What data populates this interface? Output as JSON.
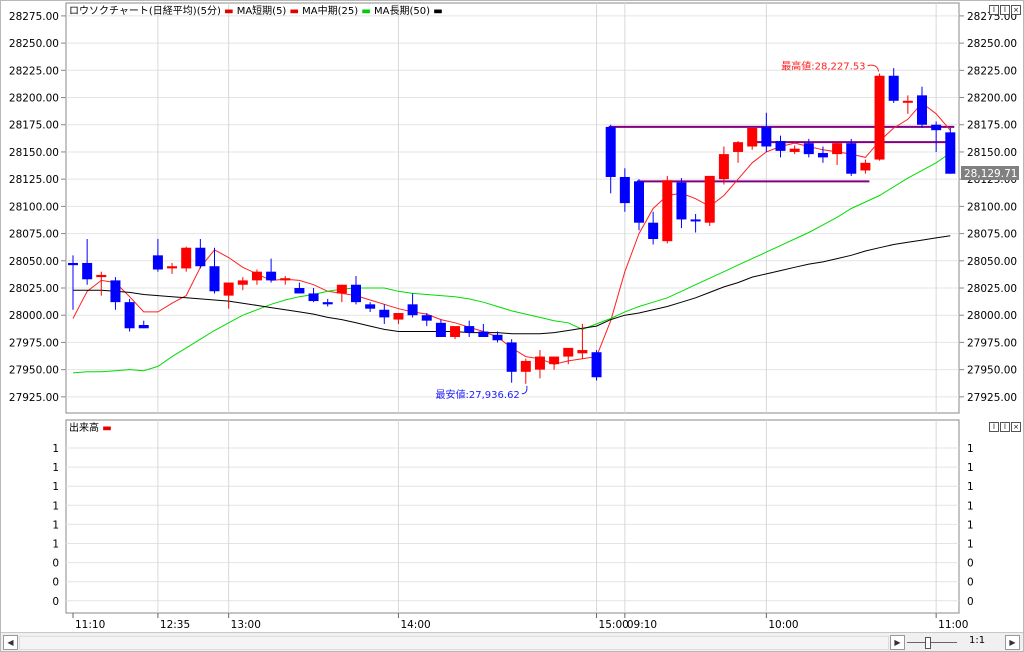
{
  "legend": {
    "title": "ロウソクチャート(日経平均)(5分)",
    "items": [
      {
        "label": "MA短期(5)",
        "color": "#e00000"
      },
      {
        "label": "MA中期(25)",
        "color": "#e00000"
      },
      {
        "label": "MA長期(50)",
        "color": "#00cc00"
      },
      {
        "label": "",
        "color": "#000000"
      }
    ]
  },
  "volume_panel": {
    "title": "出来高",
    "y_ticks": [
      "1",
      "1",
      "1",
      "1",
      "1",
      "1",
      "0",
      "0",
      "0"
    ]
  },
  "colors": {
    "up": "#ff0000",
    "down": "#0000ff",
    "ma_short": "#ff2020",
    "ma_mid": "#00dd00",
    "ma_long": "#000000",
    "range_lines": "#800080",
    "max_label": "#ff2020",
    "min_label": "#2020ff"
  },
  "scrollbar": {
    "zoom_label": "1:1"
  },
  "chart_data": {
    "type": "candlestick",
    "title": "ロウソクチャート(日経平均)(5分)",
    "y_ticks": [
      "28275.00",
      "28250.00",
      "28225.00",
      "28200.00",
      "28175.00",
      "28150.00",
      "28125.00",
      "28100.00",
      "28075.00",
      "28050.00",
      "28025.00",
      "28000.00",
      "27975.00",
      "27950.00",
      "27925.00"
    ],
    "ylim": [
      27912,
      28285
    ],
    "x_ticks": [
      "11:10",
      "12:35",
      "13:00",
      "14:00",
      "15:00",
      "09:10",
      "10:00",
      "11:00"
    ],
    "x_tick_index": [
      0,
      6,
      11,
      23,
      37,
      39,
      49,
      61
    ],
    "session_breaks": [
      6,
      11,
      23,
      37,
      39,
      49,
      61
    ],
    "last_price": "28,129.71",
    "max_label": "最高値:28,227.53",
    "min_label": "最安値:27,936.62",
    "max_index": 57,
    "min_index": 32,
    "range_lines": [
      {
        "y": 28173,
        "from": 38,
        "to": 62
      },
      {
        "y": 28159,
        "from": 48,
        "to": 62
      },
      {
        "y": 28123,
        "from": 40,
        "to": 56
      }
    ],
    "candles": [
      {
        "o": 28048,
        "h": 28055,
        "l": 28005,
        "c": 28046
      },
      {
        "o": 28048,
        "h": 28070,
        "l": 28028,
        "c": 28033
      },
      {
        "o": 28035,
        "h": 28040,
        "l": 28018,
        "c": 28037
      },
      {
        "o": 28032,
        "h": 28035,
        "l": 28005,
        "c": 28012
      },
      {
        "o": 28012,
        "h": 28015,
        "l": 27985,
        "c": 27988
      },
      {
        "o": 27991,
        "h": 27995,
        "l": 27988,
        "c": 27988
      },
      {
        "o": 28055,
        "h": 28070,
        "l": 28040,
        "c": 28042
      },
      {
        "o": 28043,
        "h": 28048,
        "l": 28038,
        "c": 28045
      },
      {
        "o": 28043,
        "h": 28063,
        "l": 28040,
        "c": 28062
      },
      {
        "o": 28062,
        "h": 28070,
        "l": 28043,
        "c": 28045
      },
      {
        "o": 28045,
        "h": 28062,
        "l": 28020,
        "c": 28022
      },
      {
        "o": 28018,
        "h": 28025,
        "l": 28006,
        "c": 28030
      },
      {
        "o": 28028,
        "h": 28035,
        "l": 28023,
        "c": 28032
      },
      {
        "o": 28032,
        "h": 28042,
        "l": 28028,
        "c": 28040
      },
      {
        "o": 28040,
        "h": 28052,
        "l": 28030,
        "c": 28032
      },
      {
        "o": 28032,
        "h": 28036,
        "l": 28028,
        "c": 28034
      },
      {
        "o": 28025,
        "h": 28030,
        "l": 28020,
        "c": 28020
      },
      {
        "o": 28020,
        "h": 28025,
        "l": 28012,
        "c": 28013
      },
      {
        "o": 28012,
        "h": 28015,
        "l": 28008,
        "c": 28010
      },
      {
        "o": 28020,
        "h": 28028,
        "l": 28012,
        "c": 28028
      },
      {
        "o": 28028,
        "h": 28036,
        "l": 28010,
        "c": 28012
      },
      {
        "o": 28010,
        "h": 28012,
        "l": 28003,
        "c": 28006
      },
      {
        "o": 28005,
        "h": 28010,
        "l": 27992,
        "c": 27998
      },
      {
        "o": 27996,
        "h": 28000,
        "l": 27992,
        "c": 28002
      },
      {
        "o": 28010,
        "h": 28020,
        "l": 27998,
        "c": 28000
      },
      {
        "o": 28000,
        "h": 28002,
        "l": 27990,
        "c": 27995
      },
      {
        "o": 27993,
        "h": 27996,
        "l": 27980,
        "c": 27980
      },
      {
        "o": 27980,
        "h": 27985,
        "l": 27978,
        "c": 27990
      },
      {
        "o": 27990,
        "h": 27995,
        "l": 27980,
        "c": 27984
      },
      {
        "o": 27985,
        "h": 27992,
        "l": 27980,
        "c": 27980
      },
      {
        "o": 27982,
        "h": 27985,
        "l": 27975,
        "c": 27977
      },
      {
        "o": 27975,
        "h": 27978,
        "l": 27938,
        "c": 27948
      },
      {
        "o": 27948,
        "h": 27960,
        "l": 27937,
        "c": 27958
      },
      {
        "o": 27950,
        "h": 27968,
        "l": 27942,
        "c": 27962
      },
      {
        "o": 27955,
        "h": 27962,
        "l": 27950,
        "c": 27962
      },
      {
        "o": 27962,
        "h": 27968,
        "l": 27955,
        "c": 27970
      },
      {
        "o": 27965,
        "h": 27992,
        "l": 27960,
        "c": 27968
      },
      {
        "o": 27966,
        "h": 27968,
        "l": 27940,
        "c": 27943
      },
      {
        "o": 28173,
        "h": 28175,
        "l": 28112,
        "c": 28127
      },
      {
        "o": 28127,
        "h": 28135,
        "l": 28095,
        "c": 28103
      },
      {
        "o": 28123,
        "h": 28125,
        "l": 28078,
        "c": 28085
      },
      {
        "o": 28085,
        "h": 28095,
        "l": 28065,
        "c": 28070
      },
      {
        "o": 28068,
        "h": 28128,
        "l": 28066,
        "c": 28124
      },
      {
        "o": 28122,
        "h": 28126,
        "l": 28080,
        "c": 28088
      },
      {
        "o": 28088,
        "h": 28093,
        "l": 28076,
        "c": 28087
      },
      {
        "o": 28085,
        "h": 28125,
        "l": 28082,
        "c": 28128
      },
      {
        "o": 28125,
        "h": 28155,
        "l": 28120,
        "c": 28148
      },
      {
        "o": 28150,
        "h": 28160,
        "l": 28140,
        "c": 28159
      },
      {
        "o": 28155,
        "h": 28172,
        "l": 28152,
        "c": 28172
      },
      {
        "o": 28173,
        "h": 28186,
        "l": 28150,
        "c": 28155
      },
      {
        "o": 28160,
        "h": 28165,
        "l": 28145,
        "c": 28151
      },
      {
        "o": 28150,
        "h": 28156,
        "l": 28148,
        "c": 28153
      },
      {
        "o": 28158,
        "h": 28162,
        "l": 28145,
        "c": 28148
      },
      {
        "o": 28149,
        "h": 28155,
        "l": 28140,
        "c": 28145
      },
      {
        "o": 28148,
        "h": 28160,
        "l": 28138,
        "c": 28158
      },
      {
        "o": 28158,
        "h": 28162,
        "l": 28128,
        "c": 28130
      },
      {
        "o": 28133,
        "h": 28143,
        "l": 28130,
        "c": 28140
      },
      {
        "o": 28143,
        "h": 28222,
        "l": 28142,
        "c": 28220
      },
      {
        "o": 28220,
        "h": 28227,
        "l": 28195,
        "c": 28197
      },
      {
        "o": 28197,
        "h": 28202,
        "l": 28185,
        "c": 28197
      },
      {
        "o": 28202,
        "h": 28210,
        "l": 28172,
        "c": 28175
      },
      {
        "o": 28175,
        "h": 28178,
        "l": 28150,
        "c": 28170
      },
      {
        "o": 28168,
        "h": 28172,
        "l": 28130,
        "c": 28130
      }
    ],
    "series": [
      {
        "name": "MA短期(5)",
        "color": "#ff2020",
        "values": [
          27997,
          28022,
          28032,
          28030,
          28017,
          28003,
          28003,
          28011,
          28018,
          28044,
          28060,
          28053,
          28044,
          28038,
          28032,
          28033,
          28032,
          28028,
          28022,
          28020,
          28018,
          28014,
          28010,
          28006,
          28003,
          28001,
          27996,
          27993,
          27989,
          27985,
          27980,
          27970,
          27962,
          27960,
          27955,
          27958,
          27960,
          27962,
          27995,
          28040,
          28075,
          28098,
          28110,
          28112,
          28107,
          28100,
          28110,
          28125,
          28140,
          28150,
          28155,
          28158,
          28155,
          28152,
          28150,
          28148,
          28145,
          28160,
          28172,
          28180,
          28195,
          28185,
          28170
        ]
      },
      {
        "name": "MA中期(25)",
        "color": "#00dd00",
        "values": [
          27947,
          27948,
          27948,
          27949,
          27950,
          27949,
          27953,
          27962,
          27970,
          27978,
          27986,
          27993,
          28000,
          28005,
          28010,
          28014,
          28017,
          28019,
          28022,
          28024,
          28025,
          28025,
          28025,
          28022,
          28020,
          28019,
          28018,
          28017,
          28015,
          28012,
          28008,
          28004,
          28001,
          27998,
          27995,
          27993,
          27987,
          27992,
          27997,
          28003,
          28008,
          28012,
          28016,
          28022,
          28028,
          28034,
          28040,
          28046,
          28052,
          28058,
          28064,
          28070,
          28076,
          28083,
          28090,
          28098,
          28104,
          28110,
          28118,
          28126,
          28133,
          28140,
          28149
        ]
      },
      {
        "name": "MA長期(50)",
        "color": "#000000",
        "values": [
          28023,
          28023,
          28023,
          28022,
          28021,
          28019,
          28018,
          28017,
          28016,
          28015,
          28014,
          28013,
          28011,
          28009,
          28007,
          28005,
          28003,
          28001,
          27998,
          27996,
          27993,
          27990,
          27987,
          27985,
          27985,
          27985,
          27985,
          27985,
          27984,
          27984,
          27984,
          27983,
          27983,
          27983,
          27984,
          27986,
          27988,
          27990,
          27996,
          28000,
          28002,
          28005,
          28008,
          28012,
          28016,
          28021,
          28026,
          28030,
          28035,
          28038,
          28041,
          28044,
          28047,
          28049,
          28052,
          28055,
          28059,
          28062,
          28065,
          28067,
          28069,
          28071,
          28073
        ]
      }
    ]
  }
}
